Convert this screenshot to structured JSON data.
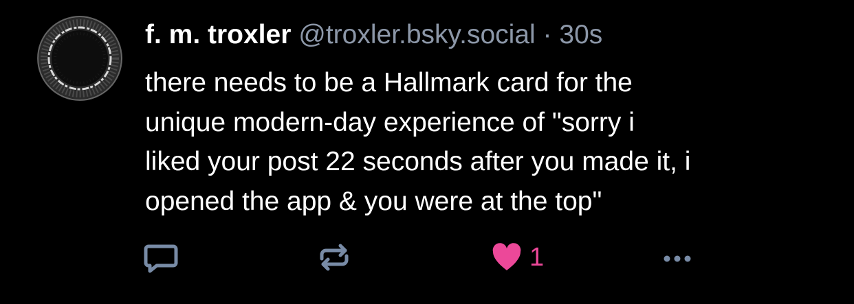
{
  "post": {
    "display_name": "f. m. troxler",
    "handle": "@troxler.bsky.social",
    "separator": "·",
    "timestamp": "30s",
    "text": "there needs to be a Hallmark card for the\nunique modern-day experience of \"sorry i\nliked your post 22 seconds after you made it, i\nopened the app & you were at the top\"",
    "avatar_icon": "avatar-image",
    "actions": {
      "reply_icon": "reply-icon",
      "repost_icon": "repost-icon",
      "like_icon": "heart-icon",
      "like_count": "1",
      "more_icon": "more-icon"
    }
  },
  "colors": {
    "background": "#000000",
    "text": "#ffffff",
    "muted": "#8c97a8",
    "icon": "#788ba6",
    "like": "#ec4899"
  }
}
